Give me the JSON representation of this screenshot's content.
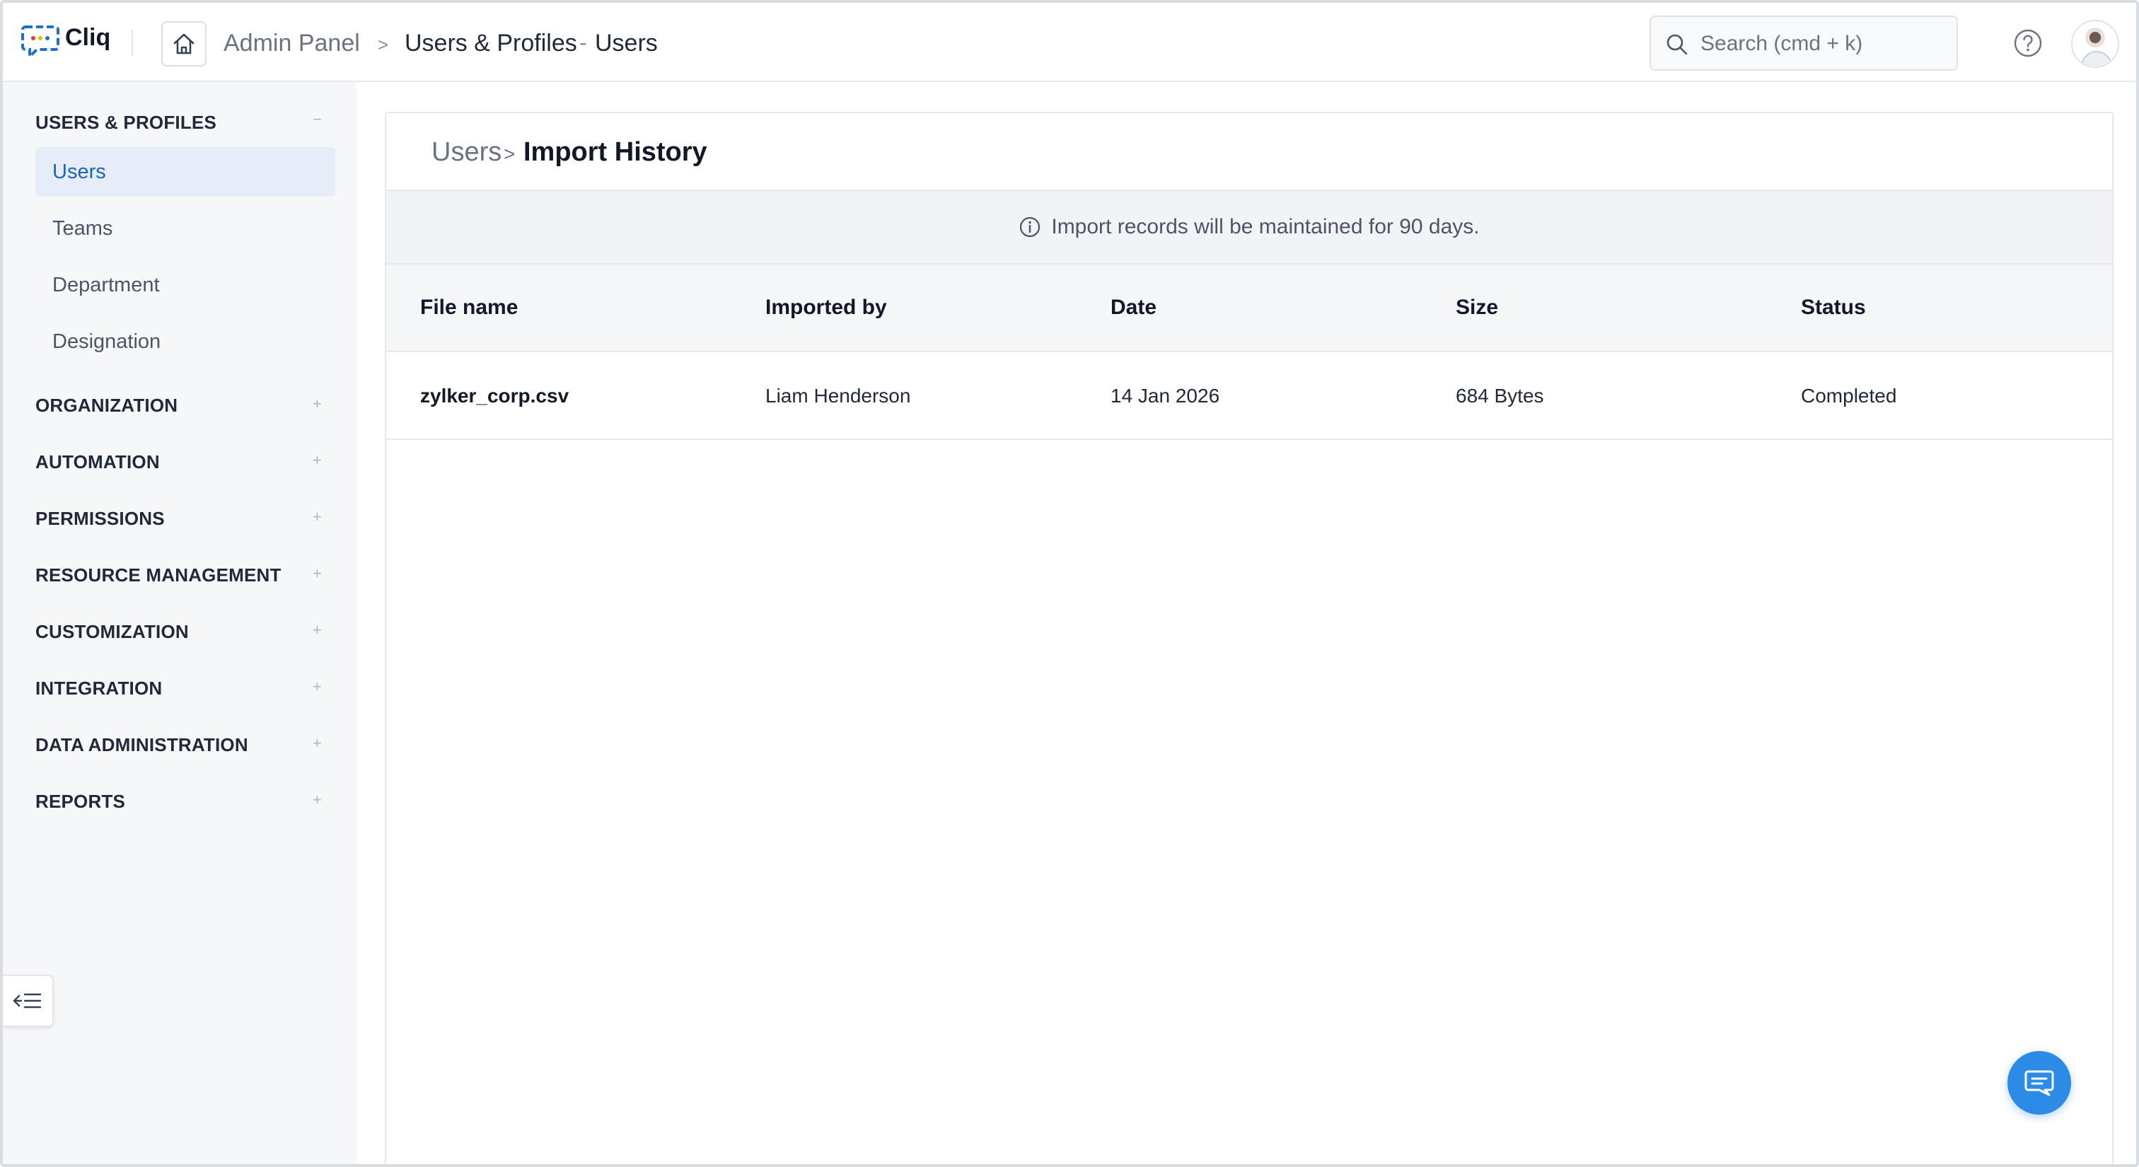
{
  "app": {
    "name": "Cliq"
  },
  "breadcrumb": {
    "admin": "Admin Panel",
    "separator": ">",
    "section": "Users & Profiles",
    "dash": "-",
    "page": "Users"
  },
  "search": {
    "placeholder": "Search (cmd + k)",
    "value": ""
  },
  "icons": {
    "logo": "cliq-logo-icon",
    "home": "home-icon",
    "search": "search-icon",
    "help": "help-icon",
    "avatar": "avatar",
    "collapse": "collapse-sidebar-icon",
    "info": "info-icon",
    "chat": "chat-icon"
  },
  "sidebar": {
    "groups": [
      {
        "label": "USERS & PROFILES",
        "toggle": "−",
        "items": [
          {
            "label": "Users",
            "active": true
          },
          {
            "label": "Teams",
            "active": false
          },
          {
            "label": "Department",
            "active": false
          },
          {
            "label": "Designation",
            "active": false
          }
        ]
      },
      {
        "label": "ORGANIZATION",
        "toggle": "+"
      },
      {
        "label": "AUTOMATION",
        "toggle": "+"
      },
      {
        "label": "PERMISSIONS",
        "toggle": "+"
      },
      {
        "label": "RESOURCE MANAGEMENT",
        "toggle": "+"
      },
      {
        "label": "CUSTOMIZATION",
        "toggle": "+"
      },
      {
        "label": "INTEGRATION",
        "toggle": "+"
      },
      {
        "label": "DATA ADMINISTRATION",
        "toggle": "+"
      },
      {
        "label": "REPORTS",
        "toggle": "+"
      }
    ]
  },
  "main": {
    "breadcrumb_parent": "Users",
    "breadcrumb_sep": ">",
    "title": "Import History",
    "notice": "Import records will be maintained for 90 days.",
    "table": {
      "columns": [
        "File name",
        "Imported by",
        "Date",
        "Size",
        "Status"
      ],
      "rows": [
        [
          "zylker_corp.csv",
          "Liam Henderson",
          "14 Jan 2026",
          "684 Bytes",
          "Completed"
        ]
      ]
    }
  },
  "colors": {
    "accent": "#2b8be6",
    "active_item_bg": "#e4edf8",
    "active_item_text": "#1f64b8",
    "sidebar_bg": "#f6f7f9"
  }
}
